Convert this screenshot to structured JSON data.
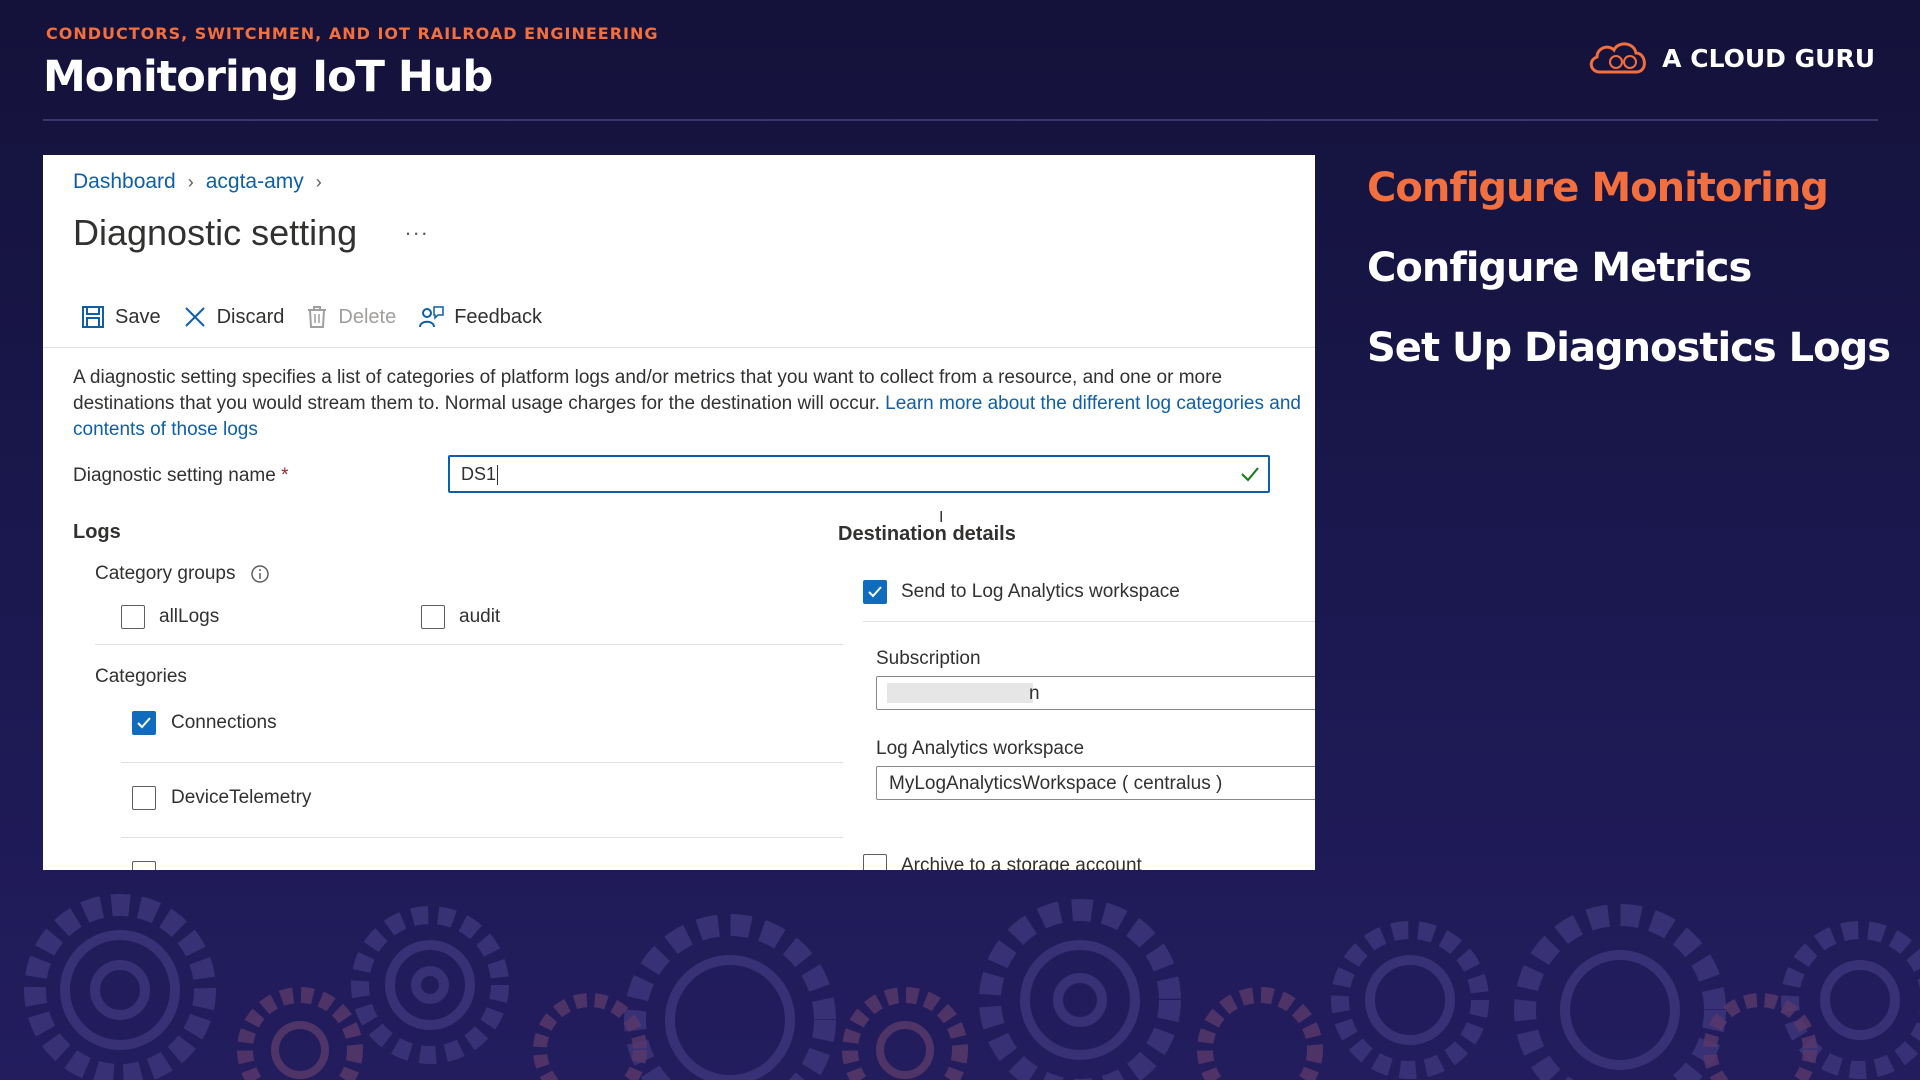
{
  "header": {
    "course_label": "CONDUCTORS, SWITCHMEN, AND IOT RAILROAD ENGINEERING",
    "lesson_title": "Monitoring IoT Hub",
    "brand_name": "A CLOUD GURU"
  },
  "topics": [
    {
      "label": "Configure Monitoring",
      "active": true
    },
    {
      "label": "Configure Metrics",
      "active": false
    },
    {
      "label": "Set Up Diagnostics Logs",
      "active": false
    }
  ],
  "portal": {
    "breadcrumb": [
      "Dashboard",
      "acgta-amy"
    ],
    "title": "Diagnostic setting",
    "more": "...",
    "toolbar": {
      "save": "Save",
      "discard": "Discard",
      "delete": "Delete",
      "feedback": "Feedback"
    },
    "description": "A diagnostic setting specifies a list of categories of platform logs and/or metrics that you want to collect from a resource, and one or more destinations that you would stream them to. Normal usage charges for the destination will occur.",
    "learn_more_link": "Learn more about the different log categories and contents of those logs",
    "name_label": "Diagnostic setting name",
    "required_mark": "*",
    "name_value": "DS1",
    "logs": {
      "heading": "Logs",
      "category_groups_label": "Category groups",
      "category_groups": [
        {
          "label": "allLogs",
          "checked": false
        },
        {
          "label": "audit",
          "checked": false
        }
      ],
      "categories_label": "Categories",
      "categories": [
        {
          "label": "Connections",
          "checked": true
        },
        {
          "label": "DeviceTelemetry",
          "checked": false
        }
      ]
    },
    "destination": {
      "heading": "Destination details",
      "send_to_log_analytics": {
        "label": "Send to Log Analytics workspace",
        "checked": true
      },
      "subscription_label": "Subscription",
      "subscription_value_suffix": "n",
      "workspace_label": "Log Analytics workspace",
      "workspace_value": "MyLogAnalyticsWorkspace ( centralus )",
      "archive": {
        "label": "Archive to a storage account",
        "checked": false
      }
    }
  },
  "colors": {
    "accent_orange": "#f36f3d",
    "azure_blue": "#0f5fa8",
    "checkbox_blue": "#0f6cbd",
    "background_navy": "#1b1850"
  }
}
